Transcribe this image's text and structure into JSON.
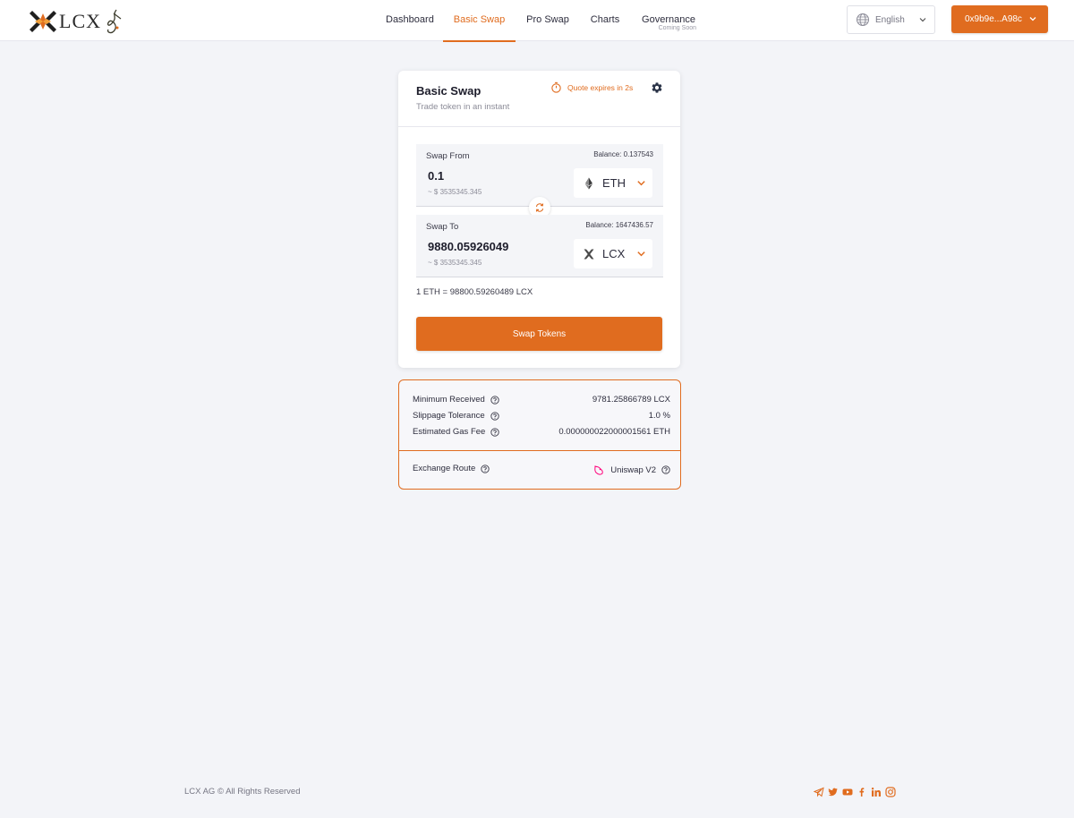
{
  "header": {
    "logo_text": "LCX",
    "nav": [
      {
        "label": "Dashboard",
        "sub": ""
      },
      {
        "label": "Basic Swap",
        "sub": ""
      },
      {
        "label": "Pro Swap",
        "sub": ""
      },
      {
        "label": "Charts",
        "sub": ""
      },
      {
        "label": "Governance",
        "sub": "Coming Soon"
      }
    ],
    "active_nav": "Basic Swap",
    "language": "English",
    "wallet": "0x9b9e...A98c"
  },
  "swap": {
    "title": "Basic Swap",
    "subtitle": "Trade token in an instant",
    "quote": "Quote expires in 2s",
    "from": {
      "label": "Swap From",
      "balance": "Balance: 0.137543",
      "amount": "0.1",
      "usd": "~ $ 3535345.345",
      "token": "ETH"
    },
    "to": {
      "label": "Swap To",
      "balance": "Balance: 1647436.57",
      "amount": "9880.05926049",
      "usd": "~ $ 3535345.345",
      "token": "LCX"
    },
    "rate": "1 ETH = 98800.59260489 LCX",
    "button": "Swap Tokens"
  },
  "details": {
    "minimum_received": {
      "label": "Minimum Received",
      "value": "9781.25866789 LCX"
    },
    "slippage": {
      "label": "Slippage Tolerance",
      "value": "1.0 %"
    },
    "gas_fee": {
      "label": "Estimated Gas Fee",
      "value": "0.000000022000001561 ETH"
    },
    "route": {
      "label": "Exchange Route",
      "value": "Uniswap V2"
    }
  },
  "footer": {
    "copyright": "LCX AG © All Rights Reserved",
    "socials": [
      "telegram-icon",
      "twitter-icon",
      "youtube-icon",
      "facebook-icon",
      "linkedin-icon",
      "instagram-icon"
    ]
  },
  "colors": {
    "accent": "#e06c1f",
    "background": "#f3f4f8"
  }
}
